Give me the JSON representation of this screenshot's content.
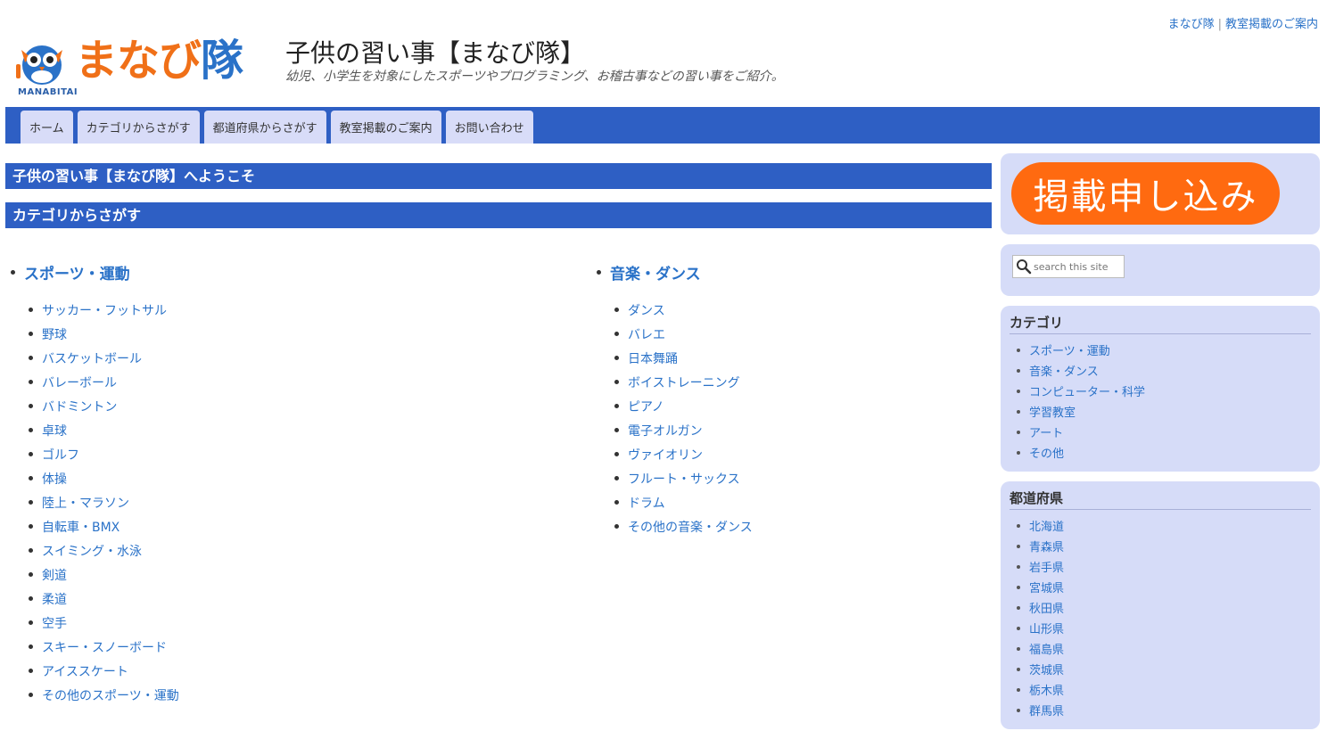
{
  "toplinks": [
    "まなび隊",
    "教室掲載のご案内"
  ],
  "logo": {
    "kana": "まなび",
    "kanji": "隊",
    "romaji": "MANABITAI"
  },
  "site": {
    "title": "子供の習い事【まなび隊】",
    "description": "幼児、小学生を対象にしたスポーツやプログラミング、お稽古事などの習い事をご紹介。"
  },
  "nav": [
    "ホーム",
    "カテゴリからさがす",
    "都道府県からさがす",
    "教室掲載のご案内",
    "お問い合わせ"
  ],
  "main": {
    "welcome": "子供の習い事【まなび隊】へようこそ",
    "section": "カテゴリからさがす",
    "left": {
      "heading": "スポーツ・運動",
      "items": [
        "サッカー・フットサル",
        "野球",
        "バスケットボール",
        "バレーボール",
        "バドミントン",
        "卓球",
        "ゴルフ",
        "体操",
        "陸上・マラソン",
        "自転車・BMX",
        "スイミング・水泳",
        "剣道",
        "柔道",
        "空手",
        "スキー・スノーボード",
        "アイススケート",
        "その他のスポーツ・運動"
      ]
    },
    "right": {
      "heading": "音楽・ダンス",
      "items": [
        "ダンス",
        "バレエ",
        "日本舞踊",
        "ボイストレーニング",
        "ピアノ",
        "電子オルガン",
        "ヴァイオリン",
        "フルート・サックス",
        "ドラム",
        "その他の音楽・ダンス"
      ]
    }
  },
  "sidebar": {
    "ad_label": "掲載申し込み",
    "search_placeholder": "search this site",
    "category": {
      "title": "カテゴリ",
      "items": [
        "スポーツ・運動",
        "音楽・ダンス",
        "コンピューター・科学",
        "学習教室",
        "アート",
        "その他"
      ]
    },
    "prefecture": {
      "title": "都道府県",
      "items": [
        "北海道",
        "青森県",
        "岩手県",
        "宮城県",
        "秋田県",
        "山形県",
        "福島県",
        "茨城県",
        "栃木県",
        "群馬県"
      ]
    }
  },
  "colors": {
    "brand_blue": "#2e5fc4",
    "ad_orange": "#ff6a10",
    "logo_orange": "#f07018",
    "link": "#2a72c8"
  }
}
